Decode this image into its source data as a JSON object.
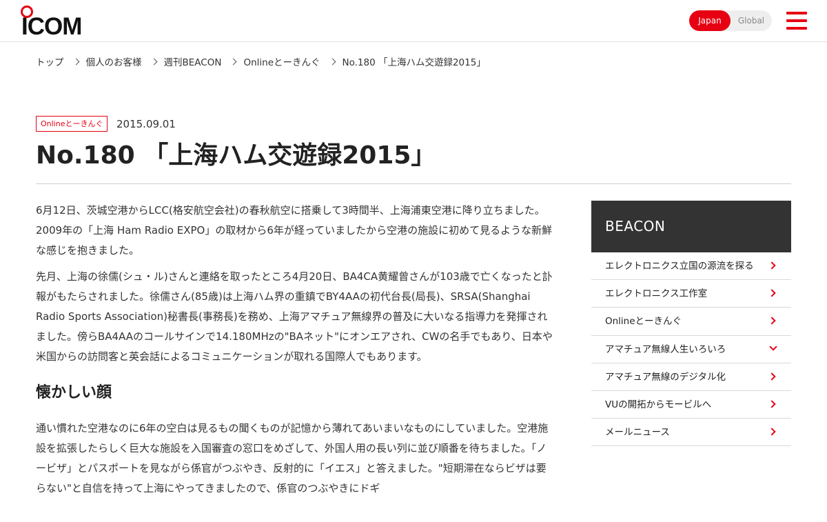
{
  "header": {
    "logo_text": "ICOM",
    "lang_japan": "Japan",
    "lang_global": "Global",
    "brand_color": "#e60012"
  },
  "breadcrumb": [
    "トップ",
    "個人のお客様",
    "週刊BEACON",
    "Onlineとーきんぐ",
    "No.180 「上海ハム交遊録2015」"
  ],
  "article": {
    "category_tag": "Onlineとーきんぐ",
    "date": "2015.09.01",
    "title": "No.180 「上海ハム交遊録2015」",
    "paragraphs": [
      "6月12日、茨城空港からLCC(格安航空会社)の春秋航空に搭乗して3時間半、上海浦東空港に降り立ちました。2009年の「上海 Ham Radio EXPO」の取材から6年が経っていましたから空港の施設に初めて見るような新鮮な感じを抱きました。",
      "先月、上海の徐儒(シュ・ル)さんと連絡を取ったところ4月20日、BA4CA黄耀曾さんが103歳で亡くなったと訃報がもたらされました。徐儒さん(85歳)は上海ハム界の重鎮でBY4AAの初代台長(局長)、SRSA(Shanghai Radio Sports Association)秘書長(事務長)を務め、上海アマチュア無線界の普及に大いなる指導力を発揮されました。傍らBA4AAのコールサインで14.180MHzの\"BAネット\"にオンエアされ、CWの名手でもあり、日本や米国からの訪問客と英会話によるコミュニケーションが取れる国際人でもあります。"
    ],
    "section_heading": "懐かしい顔",
    "section_paragraph": "通い慣れた空港なのに6年の空白は見るもの聞くものが記憶から薄れてあいまいなものにしていました。空港施設を拡張したらしく巨大な施設を入国審査の窓口をめざして、外国人用の長い列に並び順番を待ちました。「ノービザ」とパスポートを見ながら係官がつぶやき、反射的に「イエス」と答えました。\"短期滞在ならビザは要らない\"と自信を持って上海にやってきましたので、係官のつぶやきにドギ"
  },
  "sidebar": {
    "heading": "BEACON",
    "items": [
      {
        "label": "エレクトロニクス立国の源流を探る",
        "icon": "chevron-right-icon"
      },
      {
        "label": "エレクトロニクス工作室",
        "icon": "chevron-right-icon"
      },
      {
        "label": "Onlineとーきんぐ",
        "icon": "chevron-right-icon"
      },
      {
        "label": "アマチュア無線人生いろいろ",
        "icon": "chevron-down-icon"
      },
      {
        "label": "アマチュア無線のデジタル化",
        "icon": "chevron-right-icon"
      },
      {
        "label": "VUの開拓からモービルへ",
        "icon": "chevron-right-icon"
      },
      {
        "label": "メールニュース",
        "icon": "chevron-right-icon"
      }
    ]
  }
}
